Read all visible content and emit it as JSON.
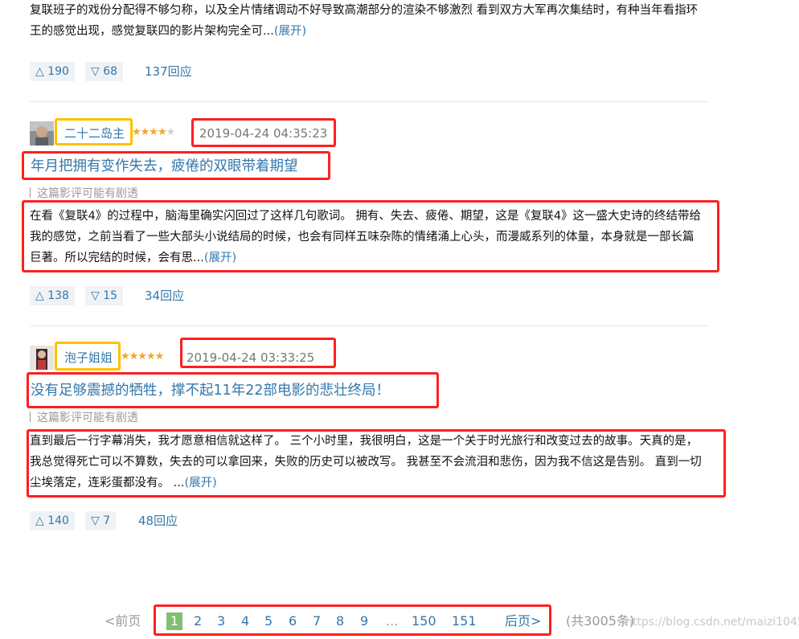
{
  "reviews": [
    {
      "text": "复联班子的戏份分配得不够匀称，以及全片情绪调动不好导致高潮部分的渲染不够激烈 看到双方大军再次集结时，有种当年看指环王的感觉出现，感觉复联四的影片架构完全可...",
      "more": "(展开)",
      "up": "190",
      "down": "68",
      "replies": "137回应"
    },
    {
      "user": "二十二岛主",
      "rating": 4,
      "time": "2019-04-24 04:35:23",
      "title": "年月把拥有变作失去，疲倦的双眼带着期望",
      "spoiler": "这篇影评可能有剧透",
      "text": "在看《复联4》的过程中，脑海里确实闪回过了这样几句歌词。 拥有、失去、疲倦、期望，这是《复联4》这一盛大史诗的终结带给我的感觉，之前当看了一些大部头小说结局的时候，也会有同样五味杂陈的情绪涌上心头，而漫威系列的体量，本身就是一部长篇巨著。所以完结的时候，会有思...",
      "more": "(展开)",
      "up": "138",
      "down": "15",
      "replies": "34回应"
    },
    {
      "user": "泡子姐姐",
      "rating": 5,
      "time": "2019-04-24 03:33:25",
      "title": "没有足够震撼的牺牲，撑不起11年22部电影的悲壮终局！",
      "spoiler": "这篇影评可能有剧透",
      "text": "直到最后一行字幕消失，我才愿意相信就这样了。 三个小时里，我很明白，这是一个关于时光旅行和改变过去的故事。天真的是，我总觉得死亡可以不算数，失去的可以拿回来，失败的历史可以被改写。 我甚至不会流泪和悲伤，因为我不信这是告别。 直到一切尘埃落定，连彩蛋都没有。 ...",
      "more": "(展开)",
      "up": "140",
      "down": "7",
      "replies": "48回应"
    }
  ],
  "icons": {
    "up": "△",
    "down": "▽",
    "star": "★"
  },
  "pagination": {
    "prev": "<前页",
    "current": "1",
    "pages": [
      "2",
      "3",
      "4",
      "5",
      "6",
      "7",
      "8",
      "9"
    ],
    "ellipsis": "...",
    "tail": [
      "150",
      "151"
    ],
    "next": "后页>",
    "total": "(共3005条)"
  },
  "watermark": "https://blog.csdn.net/maizi1045",
  "colors": {
    "link": "#3377aa",
    "highlight_red": "#ff1f1f",
    "highlight_yellow": "#ffc000",
    "current_page": "#83bf73"
  }
}
